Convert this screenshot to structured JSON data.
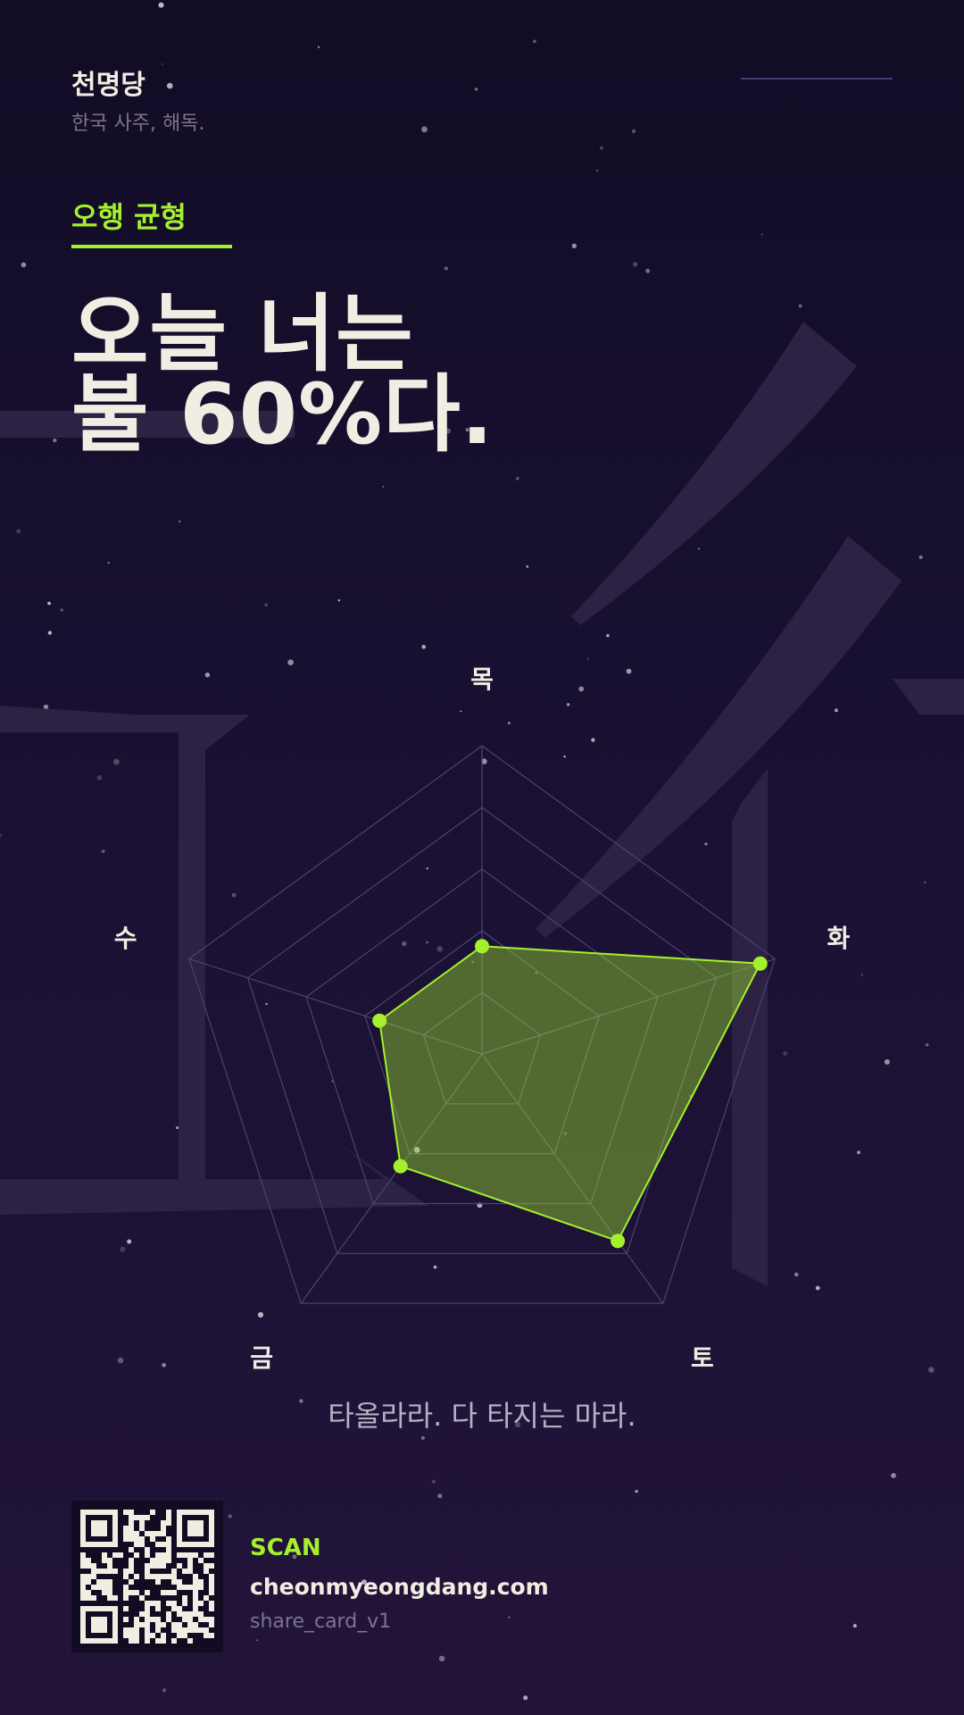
{
  "brand": {
    "name": "천명당",
    "subtitle": "한국 사주, 해독."
  },
  "section": {
    "label": "오행 균형"
  },
  "headline": {
    "line1": "오늘 너는",
    "line2": "불 60%다."
  },
  "watermark": {
    "glyph": "五行"
  },
  "chart_data": {
    "type": "radar",
    "axes": [
      "목",
      "화",
      "토",
      "금",
      "수"
    ],
    "values": [
      0.35,
      0.95,
      0.75,
      0.45,
      0.35
    ],
    "range": [
      0,
      1
    ],
    "rings": 5,
    "grid": true,
    "colors": {
      "fill": "#a5f02d",
      "point": "#a5f02d",
      "grid": "#4a4373"
    }
  },
  "tagline": "타올라라. 다 타지는 마라.",
  "footer": {
    "scan_label": "SCAN",
    "url": "cheonmyeongdang.com",
    "version": "share_card_v1"
  },
  "colors": {
    "accent": "#a5f02d",
    "background": "#150e2c",
    "text": "#f1ede2"
  }
}
